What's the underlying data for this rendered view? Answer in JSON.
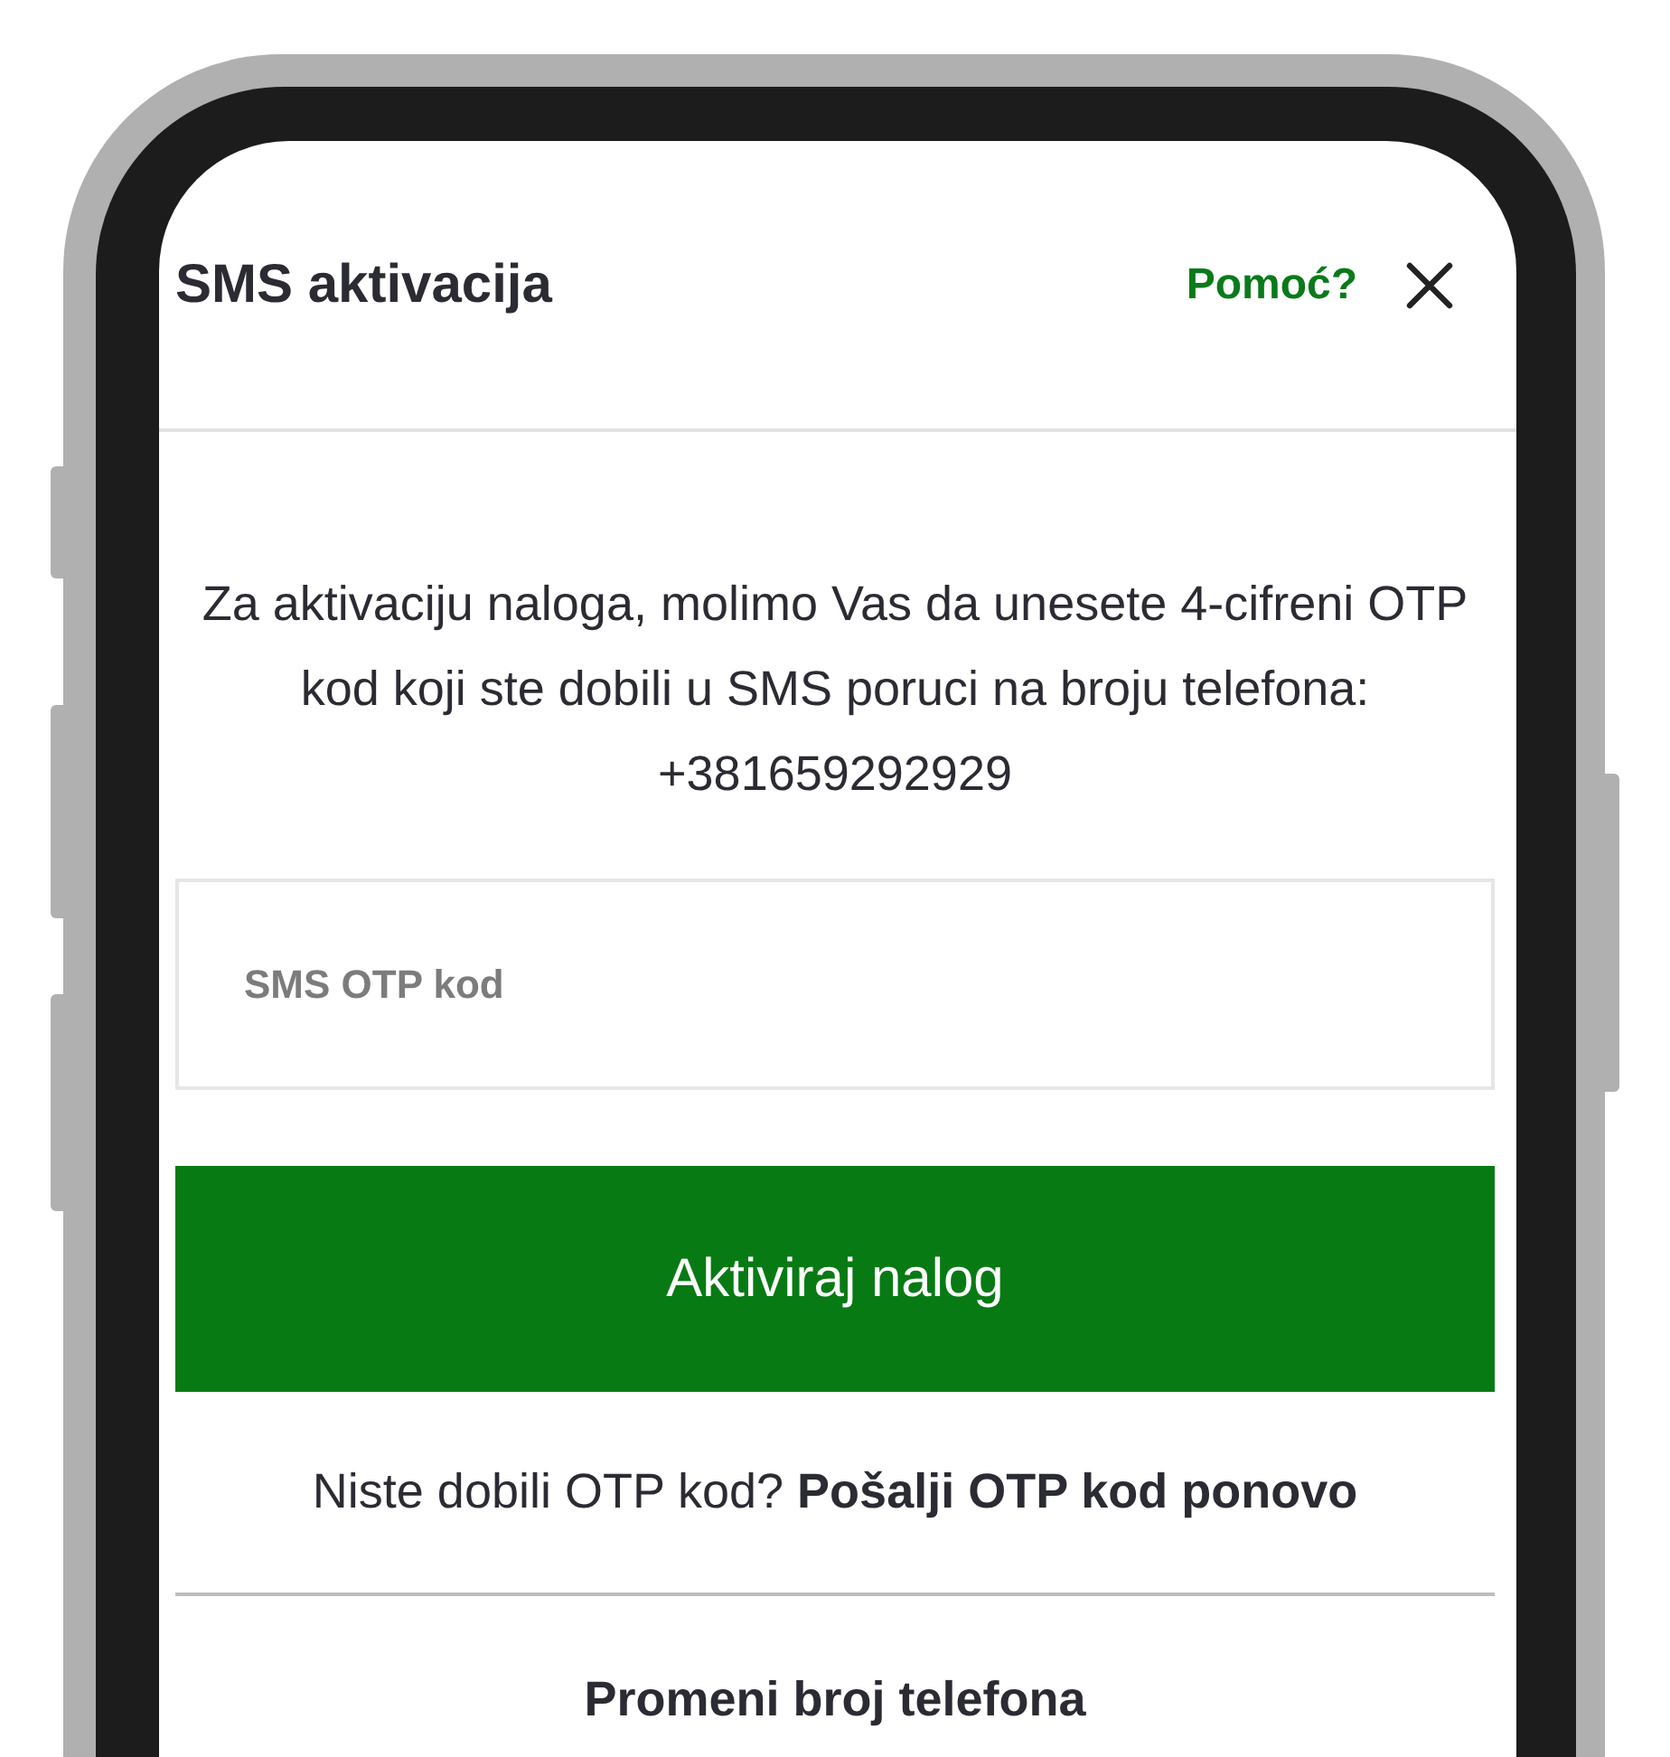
{
  "header": {
    "title": "SMS aktivacija",
    "help_link": "Pomoć?"
  },
  "instructions": "Za aktivaciju naloga, molimo Vas da unesete 4-cifreni OTP kod koji ste dobili u SMS poruci na broju telefona: +381659292929",
  "otp_field": {
    "placeholder": "SMS OTP kod"
  },
  "activate_button": "Aktiviraj nalog",
  "resend": {
    "prompt": "Niste dobili OTP kod?",
    "link": "Pošalji OTP kod ponovo"
  },
  "change_phone_link": "Promeni broj telefona"
}
